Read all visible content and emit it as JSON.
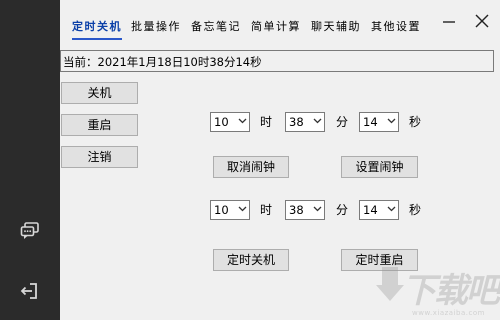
{
  "tabs": [
    {
      "label": "定时关机",
      "active": true
    },
    {
      "label": "批量操作",
      "active": false
    },
    {
      "label": "备忘笔记",
      "active": false
    },
    {
      "label": "简单计算",
      "active": false
    },
    {
      "label": "聊天辅助",
      "active": false
    },
    {
      "label": "其他设置",
      "active": false
    }
  ],
  "status": {
    "text": "当前：2021年1月18日10时38分14秒"
  },
  "actions": {
    "shutdown": "关机",
    "restart": "重启",
    "logoff": "注销"
  },
  "alarm": {
    "hour": "10",
    "minute": "38",
    "second": "14",
    "hour_unit": "时",
    "minute_unit": "分",
    "second_unit": "秒",
    "cancel_label": "取消闹钟",
    "set_label": "设置闹钟"
  },
  "timer": {
    "hour": "10",
    "minute": "38",
    "second": "14",
    "hour_unit": "时",
    "minute_unit": "分",
    "second_unit": "秒",
    "shutdown_label": "定时关机",
    "restart_label": "定时重启"
  },
  "watermark": {
    "text": "下载吧",
    "url": "www.xiazaiba.com"
  },
  "colors": {
    "sidebar": "#2b2b2b",
    "accent": "#2a57c9",
    "background": "#f0f0f0"
  },
  "icons": {
    "chat": "chat-bubbles-icon",
    "exit": "exit-icon",
    "minimize": "minimize-icon",
    "close": "close-icon"
  }
}
